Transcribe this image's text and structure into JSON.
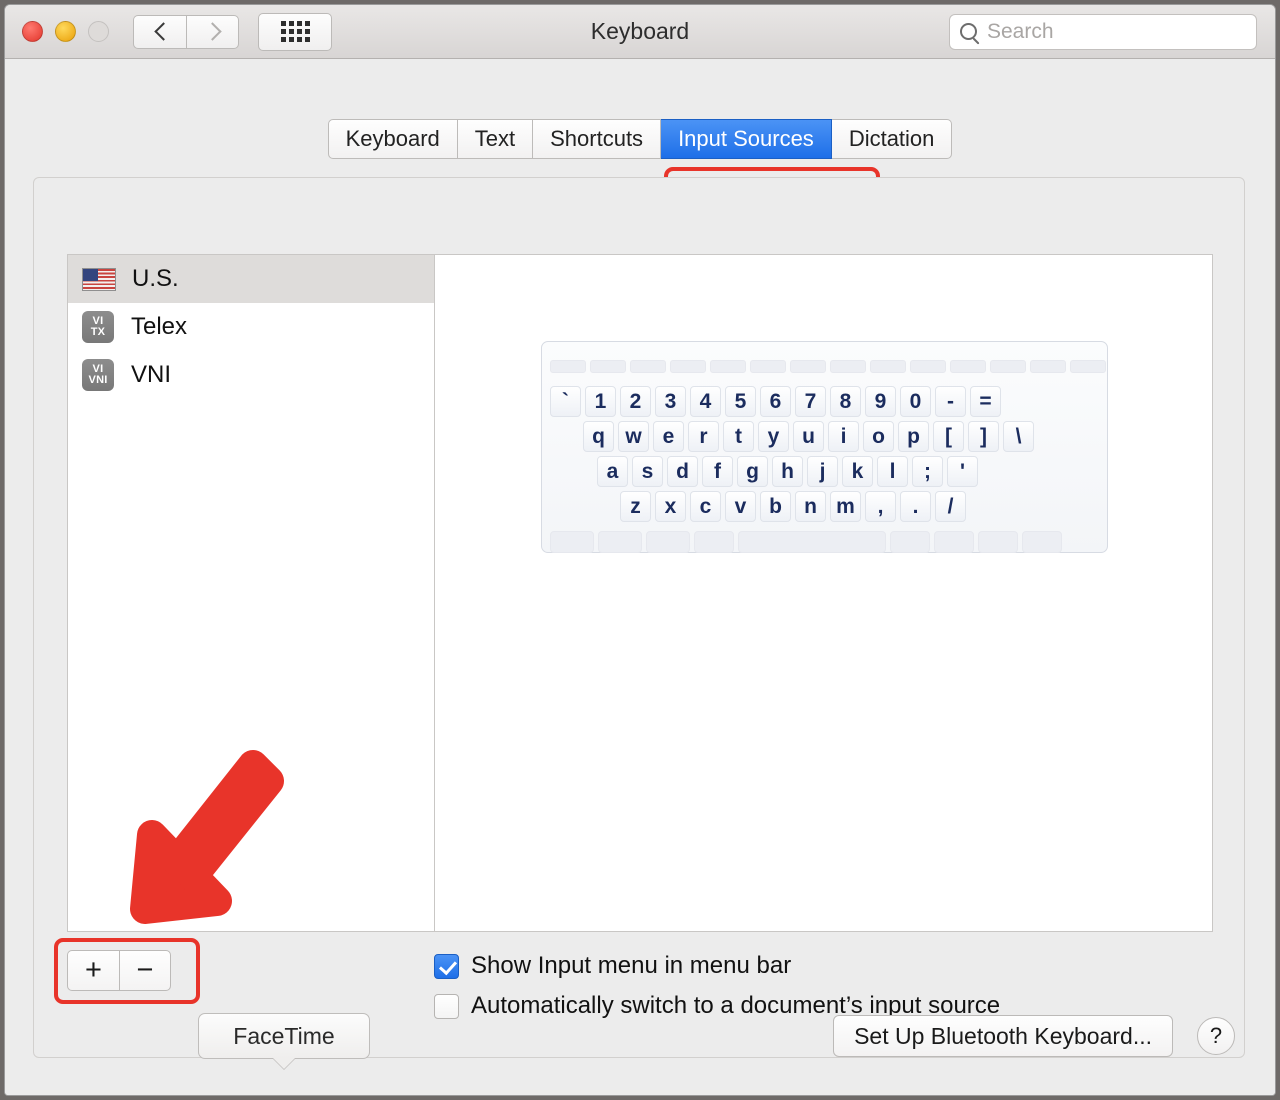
{
  "window": {
    "title": "Keyboard",
    "traffic_lights": [
      "close-button",
      "minimize-button",
      "zoom-button"
    ]
  },
  "toolbar": {
    "back_icon": "chevron-left-icon",
    "forward_icon": "chevron-right-icon",
    "grid_icon": "show-all-grid-icon",
    "search": {
      "placeholder": "Search",
      "value": "",
      "icon": "search-icon"
    }
  },
  "tabs": [
    {
      "label": "Keyboard",
      "active": false
    },
    {
      "label": "Text",
      "active": false
    },
    {
      "label": "Shortcuts",
      "active": false
    },
    {
      "label": "Input Sources",
      "active": true
    },
    {
      "label": "Dictation",
      "active": false
    }
  ],
  "input_sources": [
    {
      "label": "U.S.",
      "icon": "us-flag-icon",
      "selected": true
    },
    {
      "label": "Telex",
      "icon": "vi-tx-icon",
      "icon_top": "VI",
      "icon_bottom": "TX",
      "selected": false
    },
    {
      "label": "VNI",
      "icon": "vi-vni-icon",
      "icon_top": "VI",
      "icon_bottom": "VNI",
      "selected": false
    }
  ],
  "keyboard_preview": {
    "layout_name": "U.S.",
    "rows": [
      {
        "name": "function-row",
        "keys": [
          "",
          "",
          "",
          "",
          "",
          "",
          "",
          "",
          "",
          "",
          "",
          "",
          "",
          ""
        ]
      },
      {
        "name": "number-row",
        "keys": [
          "`",
          "1",
          "2",
          "3",
          "4",
          "5",
          "6",
          "7",
          "8",
          "9",
          "0",
          "-",
          "="
        ]
      },
      {
        "name": "top-letter-row",
        "keys": [
          "q",
          "w",
          "e",
          "r",
          "t",
          "y",
          "u",
          "i",
          "o",
          "p",
          "[",
          "]",
          "\\"
        ]
      },
      {
        "name": "home-row",
        "keys": [
          "a",
          "s",
          "d",
          "f",
          "g",
          "h",
          "j",
          "k",
          "l",
          ";",
          "'"
        ]
      },
      {
        "name": "bottom-letter-row",
        "keys": [
          "z",
          "x",
          "c",
          "v",
          "b",
          "n",
          "m",
          ",",
          ".",
          "/"
        ]
      },
      {
        "name": "modifier-row",
        "keys": [
          "",
          "",
          "",
          "",
          "",
          "",
          "",
          "",
          ""
        ]
      }
    ]
  },
  "add_remove": {
    "add_label": "+",
    "remove_label": "−"
  },
  "checkboxes": [
    {
      "label": "Show Input menu in menu bar",
      "checked": true
    },
    {
      "label": "Automatically switch to a document’s input source",
      "checked": false
    }
  ],
  "footer": {
    "tooltip_label": "FaceTime",
    "bluetooth_button": "Set Up Bluetooth Keyboard...",
    "help_button": "?"
  },
  "annotations": {
    "arrow_color": "#e8342a",
    "highlight_color": "#e8342a",
    "arrow_target": "add-remove-buttons",
    "highlight_targets": [
      "tab-input-sources",
      "add-remove-buttons"
    ]
  }
}
